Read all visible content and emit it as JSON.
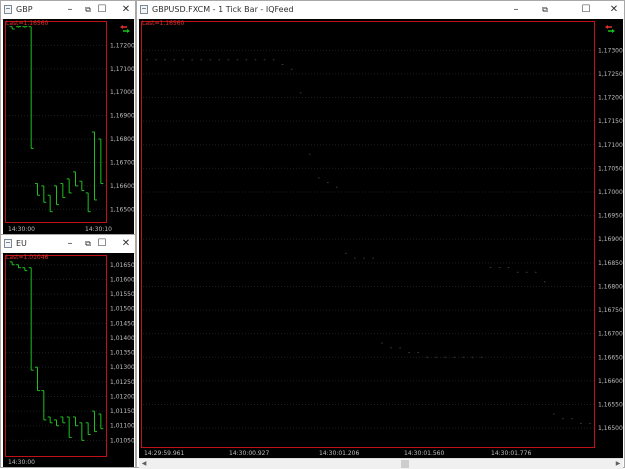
{
  "colors": {
    "chart_bg": "#000000",
    "grid": "#1e1e1e",
    "bars": "#1fbf1f",
    "dots": "#2a2a2a",
    "last": "#e23030",
    "border": "#c0101a"
  },
  "windows": {
    "w1": {
      "title": "GBP",
      "last": "Last=1.16560",
      "x_start": "14:30:00",
      "x_end": "14:30:10"
    },
    "w2": {
      "title": "EU",
      "last": "Last=1.01046",
      "x_start": "14:30:00"
    },
    "w3": {
      "title": "GBPUSD.FXCM - 1 Tick Bar - IQFeed",
      "last": "Last=1.16560",
      "x_ticks": [
        "14:29:59.961",
        "14:30:00.927",
        "14:30:01.206",
        "14:30:01.560",
        "14:30:01.776"
      ]
    }
  },
  "icons": {
    "minimize": "minimize-icon",
    "restore": "restore-icon",
    "maximize": "maximize-icon",
    "close": "close-icon",
    "arrows": "red-green-arrows-icon"
  },
  "chart_data": [
    {
      "type": "bar",
      "ylim": [
        1.1645,
        1.173
      ],
      "yticks": [
        "1,17200",
        "1,17100",
        "1,17000",
        "1,16900",
        "1,16800",
        "1,16700",
        "1,16600",
        "1,16500"
      ],
      "ytick_values": [
        1.172,
        1.171,
        1.17,
        1.169,
        1.168,
        1.167,
        1.166,
        1.165
      ],
      "x": [
        "14:30:00",
        "14:30:10"
      ],
      "series": [
        {
          "values": [
            [
              1.1727,
              1.1728
            ],
            [
              1.1728,
              1.1728
            ],
            [
              1.1728,
              1.1728
            ],
            [
              1.1676,
              1.1728
            ],
            [
              1.1656,
              1.1661
            ],
            [
              1.1653,
              1.166
            ],
            [
              1.1649,
              1.1656
            ],
            [
              1.1652,
              1.166
            ],
            [
              1.1655,
              1.1661
            ],
            [
              1.1657,
              1.1663
            ],
            [
              1.166,
              1.1666
            ],
            [
              1.1658,
              1.1662
            ],
            [
              1.1649,
              1.1657
            ],
            [
              1.1654,
              1.1683
            ],
            [
              1.1661,
              1.168
            ]
          ]
        }
      ]
    },
    {
      "type": "bar",
      "ylim": [
        1.01,
        1.0168
      ],
      "yticks": [
        "1,01650",
        "1,01600",
        "1,01550",
        "1,01500",
        "1,01450",
        "1,01400",
        "1,01350",
        "1,01300",
        "1,01250",
        "1,01200",
        "1,01150",
        "1,01100",
        "1,01050"
      ],
      "ytick_values": [
        1.0165,
        1.016,
        1.0155,
        1.015,
        1.0145,
        1.014,
        1.0135,
        1.013,
        1.0125,
        1.012,
        1.0115,
        1.011,
        1.0105
      ],
      "x": [
        "14:30:00"
      ],
      "series": [
        {
          "values": [
            [
              1.0165,
              1.0166
            ],
            [
              1.0164,
              1.0165
            ],
            [
              1.0163,
              1.0164
            ],
            [
              1.0129,
              1.0164
            ],
            [
              1.0122,
              1.013
            ],
            [
              1.0112,
              1.0122
            ],
            [
              1.0111,
              1.0113
            ],
            [
              1.011,
              1.0112
            ],
            [
              1.0111,
              1.0113
            ],
            [
              1.0106,
              1.0113
            ],
            [
              1.011,
              1.0113
            ],
            [
              1.0105,
              1.0111
            ],
            [
              1.0107,
              1.0111
            ],
            [
              1.0108,
              1.0115
            ],
            [
              1.0109,
              1.0114
            ]
          ]
        }
      ]
    },
    {
      "type": "scatter",
      "ylim": [
        1.1646,
        1.1736
      ],
      "yticks": [
        "1,17300",
        "1,17250",
        "1,17200",
        "1,17150",
        "1,17100",
        "1,17050",
        "1,17000",
        "1,16950",
        "1,16900",
        "1,16850",
        "1,16800",
        "1,16750",
        "1,16700",
        "1,16650",
        "1,16600",
        "1,16550",
        "1,16500"
      ],
      "ytick_values": [
        1.173,
        1.1725,
        1.172,
        1.1715,
        1.171,
        1.1705,
        1.17,
        1.1695,
        1.169,
        1.1685,
        1.168,
        1.1675,
        1.167,
        1.1665,
        1.166,
        1.1655,
        1.165
      ],
      "x_ticks": [
        "14:29:59.961",
        "14:30:00.927",
        "14:30:01.206",
        "14:30:01.560",
        "14:30:01.776"
      ],
      "series": [
        {
          "values": [
            1.1728,
            1.1728,
            1.1728,
            1.1728,
            1.1728,
            1.1728,
            1.1728,
            1.1728,
            1.1728,
            1.1728,
            1.1728,
            1.1728,
            1.1728,
            1.1728,
            1.1728,
            1.1727,
            1.1726,
            1.1721,
            1.1708,
            1.1703,
            1.1702,
            1.1701,
            1.1687,
            1.1686,
            1.1686,
            1.1686,
            1.1668,
            1.1667,
            1.1667,
            1.1666,
            1.1666,
            1.1665,
            1.1665,
            1.1665,
            1.1665,
            1.1665,
            1.1665,
            1.1665,
            1.1684,
            1.1684,
            1.1684,
            1.1683,
            1.1683,
            1.1683,
            1.1681,
            1.1653,
            1.1652,
            1.1652,
            1.1651,
            1.1651
          ]
        }
      ]
    }
  ]
}
